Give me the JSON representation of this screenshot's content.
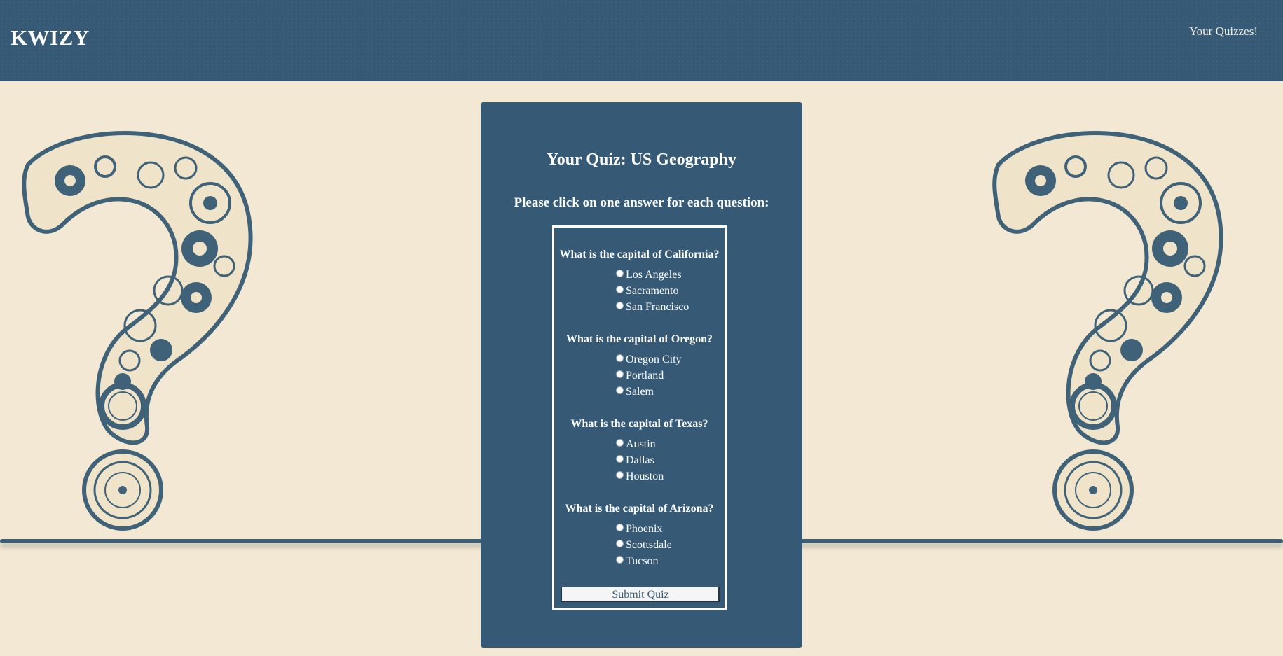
{
  "header": {
    "brand": "KWIZY",
    "nav_link": "Your Quizzes!"
  },
  "quiz": {
    "title": "Your Quiz: US Geography",
    "instructions": "Please click on one answer for each question:",
    "questions": [
      {
        "text": "What is the capital of California?",
        "options": [
          "Los Angeles",
          "Sacramento",
          "San Francisco"
        ]
      },
      {
        "text": "What is the capital of Oregon?",
        "options": [
          "Oregon City",
          "Portland",
          "Salem"
        ]
      },
      {
        "text": "What is the capital of Texas?",
        "options": [
          "Austin",
          "Dallas",
          "Houston"
        ]
      },
      {
        "text": "What is the capital of Arizona?",
        "options": [
          "Phoenix",
          "Scottsdale",
          "Tucson"
        ]
      }
    ],
    "submit_label": "Submit Quiz"
  },
  "colors": {
    "header_bg": "#365a76",
    "page_bg": "#f2e8d3",
    "card_bg": "#365a76"
  },
  "decor": {
    "left_icon": "gear-question-mark-icon",
    "right_icon": "gear-question-mark-icon"
  }
}
